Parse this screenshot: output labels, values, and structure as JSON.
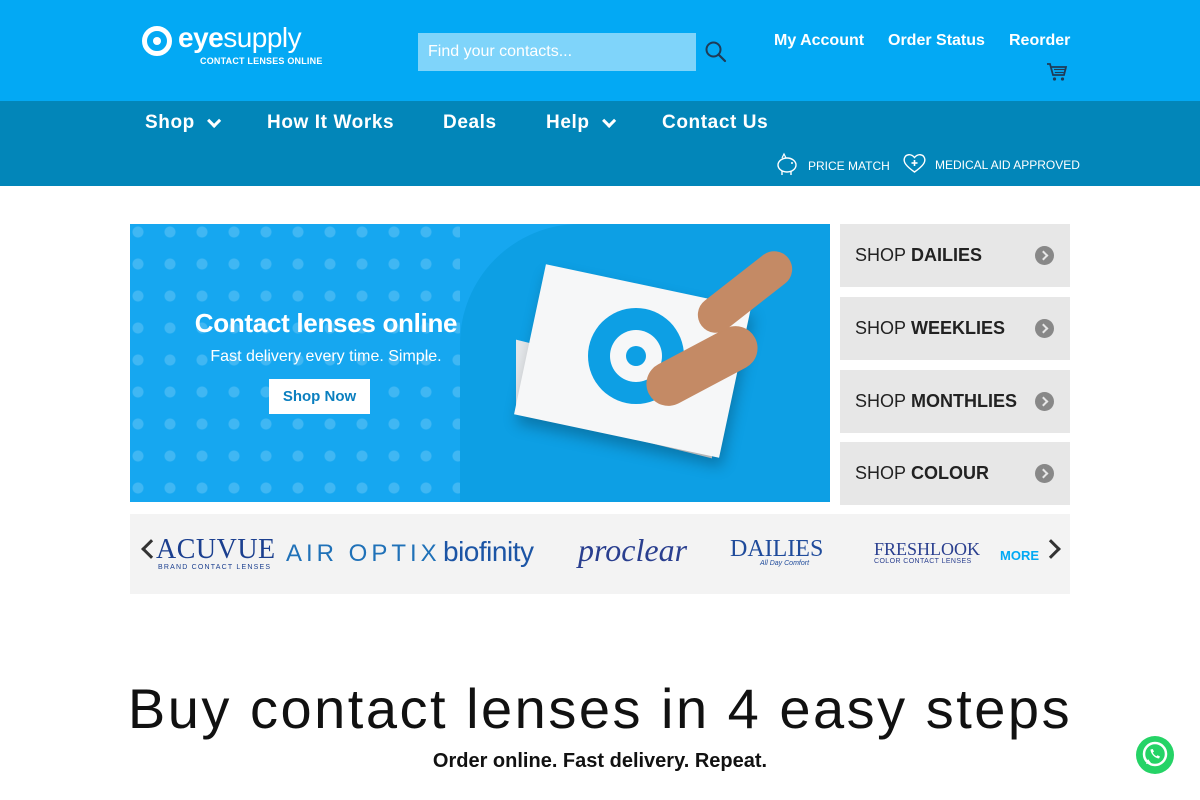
{
  "header": {
    "logo": {
      "name_bold": "eye",
      "name_light": "supply",
      "tagline": "CONTACT LENSES ONLINE"
    },
    "search": {
      "placeholder": "Find your contacts...",
      "value": ""
    },
    "links": [
      {
        "label": "My Account"
      },
      {
        "label": "Order Status"
      },
      {
        "label": "Reorder"
      }
    ],
    "icons": {
      "search": "search-icon",
      "cart": "cart-icon"
    }
  },
  "nav": {
    "items": [
      {
        "label": "Shop",
        "has_dropdown": true
      },
      {
        "label": "How It Works",
        "has_dropdown": false
      },
      {
        "label": "Deals",
        "has_dropdown": false
      },
      {
        "label": "Help",
        "has_dropdown": true
      },
      {
        "label": "Contact Us",
        "has_dropdown": false
      }
    ],
    "badges": [
      {
        "label": "PRICE MATCH",
        "icon": "piggy-bank-icon"
      },
      {
        "label": "MEDICAL AID APPROVED",
        "icon": "heart-plus-icon"
      }
    ]
  },
  "hero": {
    "title": "Contact lenses online",
    "subtitle": "Fast delivery every time. Simple.",
    "button": "Shop Now"
  },
  "shop_buttons": [
    {
      "prefix": "SHOP",
      "label": "DAILIES"
    },
    {
      "prefix": "SHOP",
      "label": "WEEKLIES"
    },
    {
      "prefix": "SHOP",
      "label": "MONTHLIES"
    },
    {
      "prefix": "SHOP",
      "label": "COLOUR"
    }
  ],
  "brands": {
    "items": [
      {
        "name": "ACUVUE",
        "sub": "BRAND CONTACT LENSES"
      },
      {
        "name": "AIR OPTIX",
        "sub": ""
      },
      {
        "name": "biofinity",
        "sub": ""
      },
      {
        "name": "proclear",
        "sub": ""
      },
      {
        "name": "DAILIES",
        "sub": "All Day Comfort"
      },
      {
        "name": "FRESHLOOK",
        "sub": "COLOR CONTACT LENSES"
      }
    ],
    "more": "MORE"
  },
  "section": {
    "heading": "Buy contact lenses in 4 easy steps",
    "subheading": "Order online. Fast delivery. Repeat."
  },
  "colors": {
    "header_bg": "#03a9f4",
    "nav_bg": "#0286b9",
    "accent": "#03a9f4",
    "whatsapp": "#25d366"
  }
}
